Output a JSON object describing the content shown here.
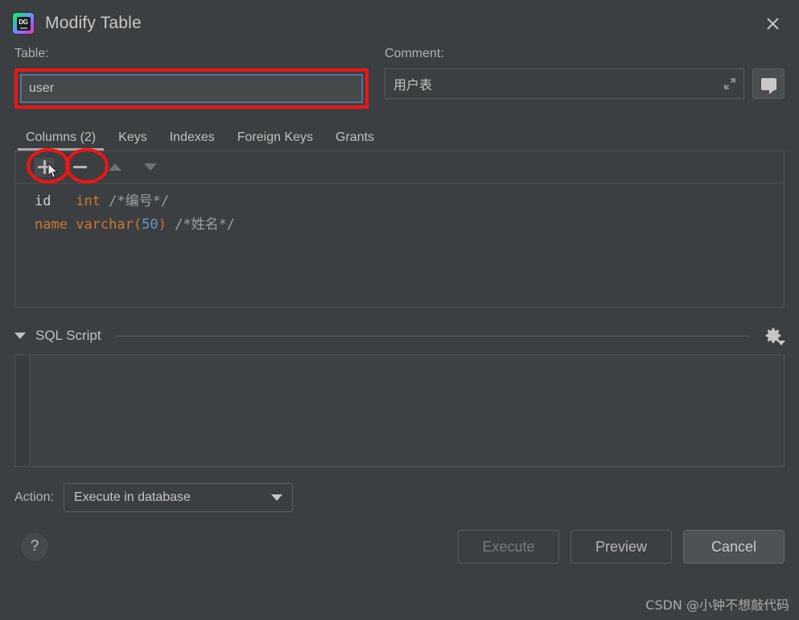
{
  "window": {
    "title": "Modify Table",
    "app_icon": "datagrip-icon",
    "close_icon": "close-icon"
  },
  "fields": {
    "table": {
      "label": "Table:",
      "value": "user",
      "annotated": true
    },
    "comment": {
      "label": "Comment:",
      "value": "用户表",
      "expand_icon": "expand-diagonal-icon",
      "comment_button_icon": "speech-bubble-icon"
    }
  },
  "tabs": [
    {
      "label": "Columns (2)",
      "selected": true
    },
    {
      "label": "Keys",
      "selected": false
    },
    {
      "label": "Indexes",
      "selected": false
    },
    {
      "label": "Foreign Keys",
      "selected": false
    },
    {
      "label": "Grants",
      "selected": false
    }
  ],
  "columns_toolbar": {
    "add_icon": "plus-icon",
    "remove_icon": "minus-icon",
    "move_up_icon": "triangle-up-icon",
    "move_down_icon": "triangle-down-icon"
  },
  "columns": [
    {
      "name": "id",
      "name_style": "plain",
      "type": "int",
      "length": "",
      "comment": "/*编号*/"
    },
    {
      "name": "name",
      "name_style": "highlight",
      "type": "varchar",
      "length": "50",
      "comment": "/*姓名*/"
    }
  ],
  "sql_script": {
    "title": "SQL Script",
    "collapse_icon": "triangle-down-icon",
    "settings_icon": "gear-icon",
    "content": ""
  },
  "action": {
    "label": "Action:",
    "selected": "Execute in database",
    "caret_icon": "chevron-down-icon"
  },
  "footer": {
    "help_label": "?",
    "buttons": [
      {
        "label": "Execute",
        "state": "disabled"
      },
      {
        "label": "Preview",
        "state": "normal"
      },
      {
        "label": "Cancel",
        "state": "default"
      }
    ]
  },
  "watermark": "CSDN @小钟不想敲代码",
  "colors": {
    "background": "#3c3f41",
    "annotation_red": "#f01414",
    "focus_blue": "#5e7a9e",
    "keyword_orange": "#cc7832",
    "number_blue": "#6897bb",
    "comment_gray": "#9aa0a6"
  }
}
